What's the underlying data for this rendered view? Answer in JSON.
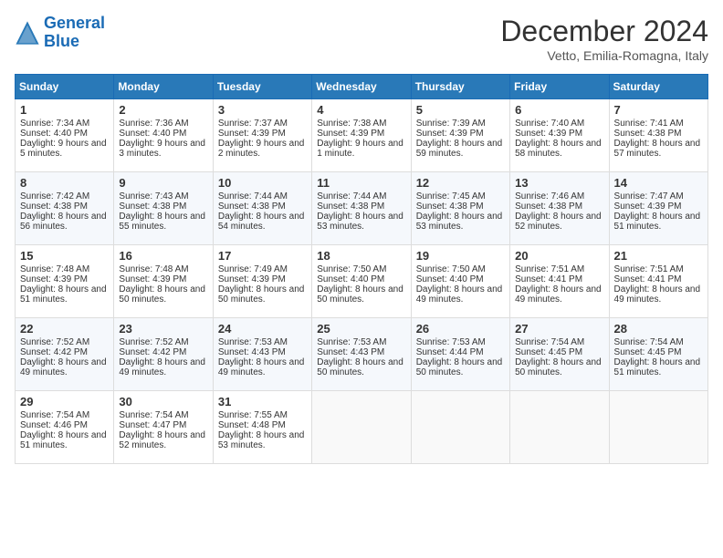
{
  "logo": {
    "line1": "General",
    "line2": "Blue"
  },
  "title": "December 2024",
  "subtitle": "Vetto, Emilia-Romagna, Italy",
  "days_of_week": [
    "Sunday",
    "Monday",
    "Tuesday",
    "Wednesday",
    "Thursday",
    "Friday",
    "Saturday"
  ],
  "weeks": [
    [
      {
        "day": 1,
        "sunrise": "7:34 AM",
        "sunset": "4:40 PM",
        "daylight": "9 hours and 5 minutes."
      },
      {
        "day": 2,
        "sunrise": "7:36 AM",
        "sunset": "4:40 PM",
        "daylight": "9 hours and 3 minutes."
      },
      {
        "day": 3,
        "sunrise": "7:37 AM",
        "sunset": "4:39 PM",
        "daylight": "9 hours and 2 minutes."
      },
      {
        "day": 4,
        "sunrise": "7:38 AM",
        "sunset": "4:39 PM",
        "daylight": "9 hours and 1 minute."
      },
      {
        "day": 5,
        "sunrise": "7:39 AM",
        "sunset": "4:39 PM",
        "daylight": "8 hours and 59 minutes."
      },
      {
        "day": 6,
        "sunrise": "7:40 AM",
        "sunset": "4:39 PM",
        "daylight": "8 hours and 58 minutes."
      },
      {
        "day": 7,
        "sunrise": "7:41 AM",
        "sunset": "4:38 PM",
        "daylight": "8 hours and 57 minutes."
      }
    ],
    [
      {
        "day": 8,
        "sunrise": "7:42 AM",
        "sunset": "4:38 PM",
        "daylight": "8 hours and 56 minutes."
      },
      {
        "day": 9,
        "sunrise": "7:43 AM",
        "sunset": "4:38 PM",
        "daylight": "8 hours and 55 minutes."
      },
      {
        "day": 10,
        "sunrise": "7:44 AM",
        "sunset": "4:38 PM",
        "daylight": "8 hours and 54 minutes."
      },
      {
        "day": 11,
        "sunrise": "7:44 AM",
        "sunset": "4:38 PM",
        "daylight": "8 hours and 53 minutes."
      },
      {
        "day": 12,
        "sunrise": "7:45 AM",
        "sunset": "4:38 PM",
        "daylight": "8 hours and 53 minutes."
      },
      {
        "day": 13,
        "sunrise": "7:46 AM",
        "sunset": "4:38 PM",
        "daylight": "8 hours and 52 minutes."
      },
      {
        "day": 14,
        "sunrise": "7:47 AM",
        "sunset": "4:39 PM",
        "daylight": "8 hours and 51 minutes."
      }
    ],
    [
      {
        "day": 15,
        "sunrise": "7:48 AM",
        "sunset": "4:39 PM",
        "daylight": "8 hours and 51 minutes."
      },
      {
        "day": 16,
        "sunrise": "7:48 AM",
        "sunset": "4:39 PM",
        "daylight": "8 hours and 50 minutes."
      },
      {
        "day": 17,
        "sunrise": "7:49 AM",
        "sunset": "4:39 PM",
        "daylight": "8 hours and 50 minutes."
      },
      {
        "day": 18,
        "sunrise": "7:50 AM",
        "sunset": "4:40 PM",
        "daylight": "8 hours and 50 minutes."
      },
      {
        "day": 19,
        "sunrise": "7:50 AM",
        "sunset": "4:40 PM",
        "daylight": "8 hours and 49 minutes."
      },
      {
        "day": 20,
        "sunrise": "7:51 AM",
        "sunset": "4:41 PM",
        "daylight": "8 hours and 49 minutes."
      },
      {
        "day": 21,
        "sunrise": "7:51 AM",
        "sunset": "4:41 PM",
        "daylight": "8 hours and 49 minutes."
      }
    ],
    [
      {
        "day": 22,
        "sunrise": "7:52 AM",
        "sunset": "4:42 PM",
        "daylight": "8 hours and 49 minutes."
      },
      {
        "day": 23,
        "sunrise": "7:52 AM",
        "sunset": "4:42 PM",
        "daylight": "8 hours and 49 minutes."
      },
      {
        "day": 24,
        "sunrise": "7:53 AM",
        "sunset": "4:43 PM",
        "daylight": "8 hours and 49 minutes."
      },
      {
        "day": 25,
        "sunrise": "7:53 AM",
        "sunset": "4:43 PM",
        "daylight": "8 hours and 50 minutes."
      },
      {
        "day": 26,
        "sunrise": "7:53 AM",
        "sunset": "4:44 PM",
        "daylight": "8 hours and 50 minutes."
      },
      {
        "day": 27,
        "sunrise": "7:54 AM",
        "sunset": "4:45 PM",
        "daylight": "8 hours and 50 minutes."
      },
      {
        "day": 28,
        "sunrise": "7:54 AM",
        "sunset": "4:45 PM",
        "daylight": "8 hours and 51 minutes."
      }
    ],
    [
      {
        "day": 29,
        "sunrise": "7:54 AM",
        "sunset": "4:46 PM",
        "daylight": "8 hours and 51 minutes."
      },
      {
        "day": 30,
        "sunrise": "7:54 AM",
        "sunset": "4:47 PM",
        "daylight": "8 hours and 52 minutes."
      },
      {
        "day": 31,
        "sunrise": "7:55 AM",
        "sunset": "4:48 PM",
        "daylight": "8 hours and 53 minutes."
      },
      null,
      null,
      null,
      null
    ]
  ]
}
